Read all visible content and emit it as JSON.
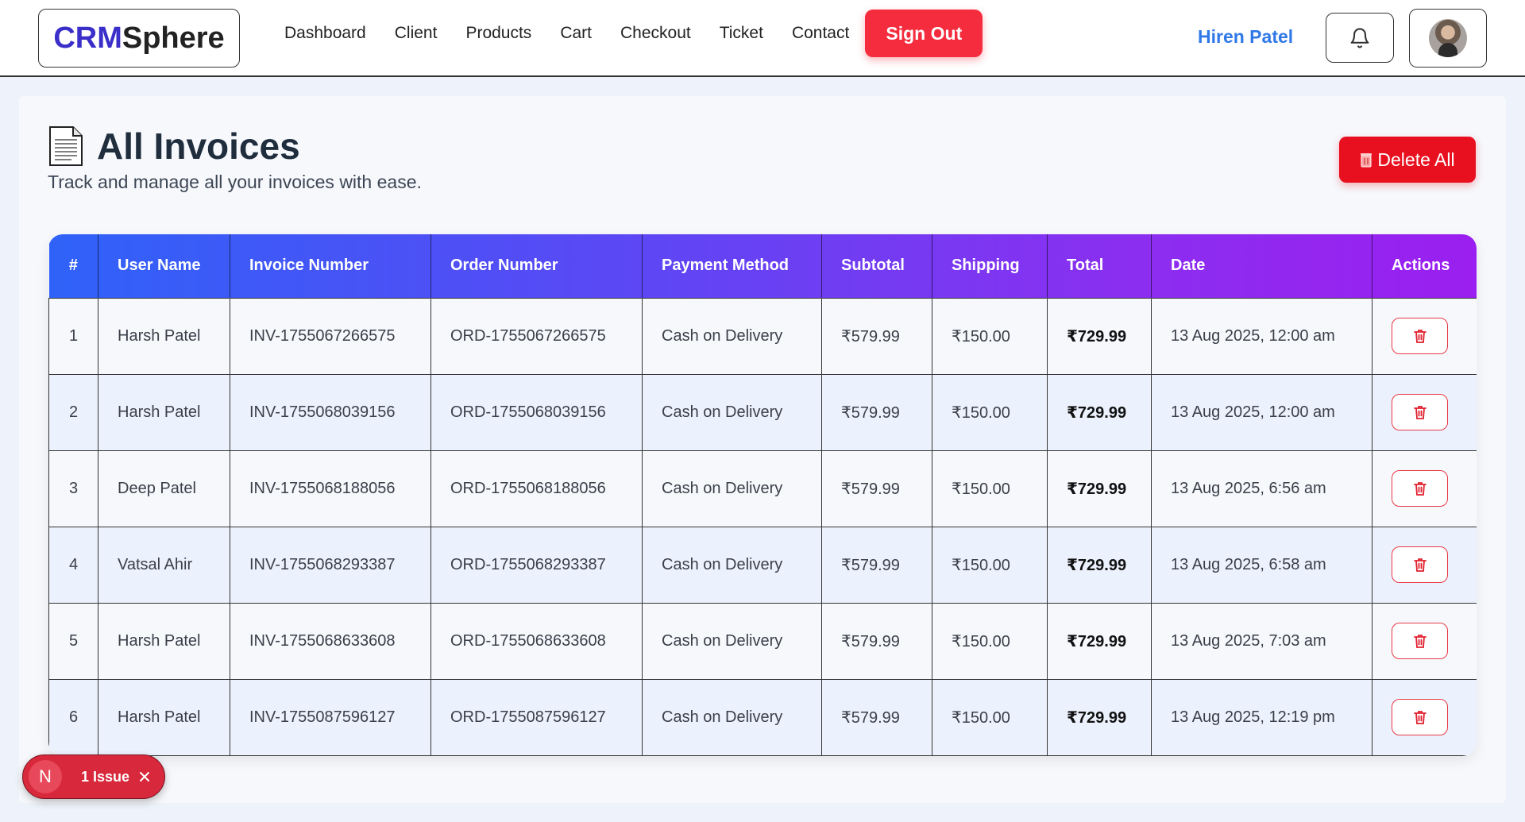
{
  "brand": {
    "part1": "CRM",
    "part2": "Sphere"
  },
  "nav": {
    "links": [
      "Dashboard",
      "Client",
      "Products",
      "Cart",
      "Checkout",
      "Ticket",
      "Contact"
    ],
    "sign_out": "Sign Out"
  },
  "user": {
    "name": "Hiren Patel"
  },
  "page": {
    "title": "All Invoices",
    "subtitle": "Track and manage all your invoices with ease.",
    "delete_all": "Delete All"
  },
  "table": {
    "headers": [
      "#",
      "User Name",
      "Invoice Number",
      "Order Number",
      "Payment Method",
      "Subtotal",
      "Shipping",
      "Total",
      "Date",
      "Actions"
    ],
    "rows": [
      {
        "num": "1",
        "user": "Harsh Patel",
        "invoice": "INV-1755067266575",
        "order": "ORD-1755067266575",
        "payment": "Cash on Delivery",
        "subtotal": "₹579.99",
        "shipping": "₹150.00",
        "total": "₹729.99",
        "date": "13 Aug 2025, 12:00 am"
      },
      {
        "num": "2",
        "user": "Harsh Patel",
        "invoice": "INV-1755068039156",
        "order": "ORD-1755068039156",
        "payment": "Cash on Delivery",
        "subtotal": "₹579.99",
        "shipping": "₹150.00",
        "total": "₹729.99",
        "date": "13 Aug 2025, 12:00 am"
      },
      {
        "num": "3",
        "user": "Deep Patel",
        "invoice": "INV-1755068188056",
        "order": "ORD-1755068188056",
        "payment": "Cash on Delivery",
        "subtotal": "₹579.99",
        "shipping": "₹150.00",
        "total": "₹729.99",
        "date": "13 Aug 2025, 6:56 am"
      },
      {
        "num": "4",
        "user": "Vatsal Ahir",
        "invoice": "INV-1755068293387",
        "order": "ORD-1755068293387",
        "payment": "Cash on Delivery",
        "subtotal": "₹579.99",
        "shipping": "₹150.00",
        "total": "₹729.99",
        "date": "13 Aug 2025, 6:58 am"
      },
      {
        "num": "5",
        "user": "Harsh Patel",
        "invoice": "INV-1755068633608",
        "order": "ORD-1755068633608",
        "payment": "Cash on Delivery",
        "subtotal": "₹579.99",
        "shipping": "₹150.00",
        "total": "₹729.99",
        "date": "13 Aug 2025, 7:03 am"
      },
      {
        "num": "6",
        "user": "Harsh Patel",
        "invoice": "INV-1755087596127",
        "order": "ORD-1755087596127",
        "payment": "Cash on Delivery",
        "subtotal": "₹579.99",
        "shipping": "₹150.00",
        "total": "₹729.99",
        "date": "13 Aug 2025, 12:19 pm"
      }
    ]
  },
  "issue_badge": {
    "letter": "N",
    "label": "1 Issue"
  },
  "colors": {
    "brand_accent": "#3b2fc9",
    "danger": "#e8101f",
    "username": "#2f78e8",
    "header_gradient_start": "#2f62f8",
    "header_gradient_end": "#9b1ff0"
  },
  "icons": {
    "bell": "bell-icon",
    "avatar": "avatar-image",
    "document": "document-icon",
    "trash": "trash-icon",
    "close": "close-icon"
  }
}
